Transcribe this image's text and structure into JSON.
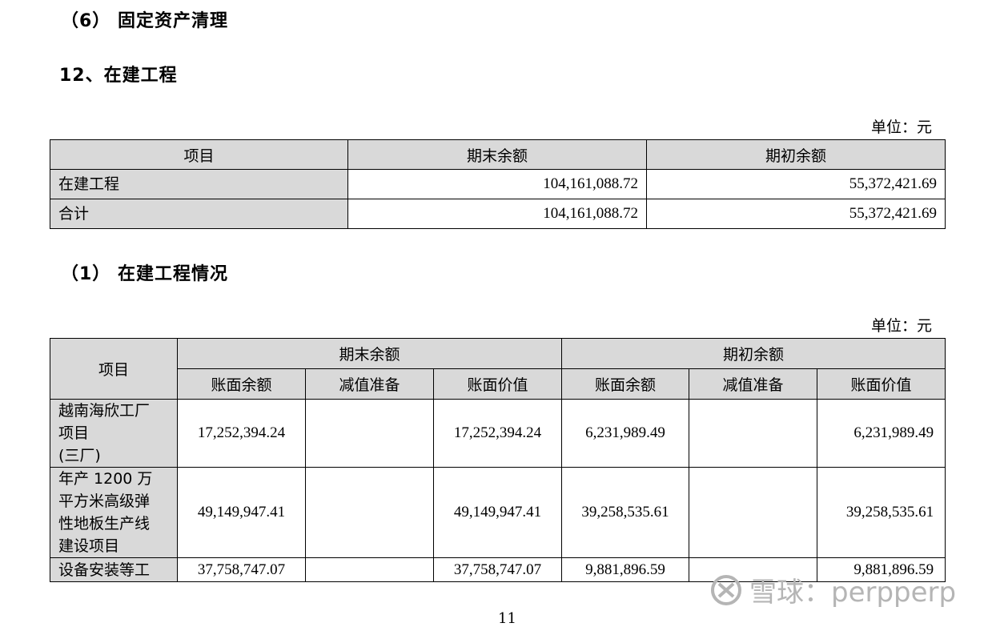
{
  "headings": {
    "fixed_asset_cleanup": "（6） 固定资产清理",
    "construction_in_progress": "12、在建工程",
    "cip_details": "（1） 在建工程情况"
  },
  "unit_label": "单位：元",
  "table1": {
    "headers": [
      "项目",
      "期末余额",
      "期初余额"
    ],
    "rows": [
      {
        "item": "在建工程",
        "end": "104,161,088.72",
        "begin": "55,372,421.69"
      },
      {
        "item": "合计",
        "end": "104,161,088.72",
        "begin": "55,372,421.69"
      }
    ]
  },
  "table2": {
    "item_header": "项目",
    "group_headers": [
      "期末余额",
      "期初余额"
    ],
    "sub_headers": [
      "账面余额",
      "减值准备",
      "账面价值",
      "账面余额",
      "减值准备",
      "账面价值"
    ],
    "rows": [
      {
        "item_lines": [
          "越南海欣工厂",
          "项目",
          "(三厂)"
        ],
        "values": [
          "17,252,394.24",
          "",
          "17,252,394.24",
          "6,231,989.49",
          "",
          "6,231,989.49"
        ]
      },
      {
        "item_lines": [
          "年产 1200 万",
          "平方米高级弹",
          "性地板生产线",
          "建设项目"
        ],
        "values": [
          "49,149,947.41",
          "",
          "49,149,947.41",
          "39,258,535.61",
          "",
          "39,258,535.61"
        ]
      },
      {
        "item_lines": [
          "设备安装等工"
        ],
        "values": [
          "37,758,747.07",
          "",
          "37,758,747.07",
          "9,881,896.59",
          "",
          "9,881,896.59"
        ]
      }
    ]
  },
  "watermark": "雪球：perpperp",
  "page_number": "11"
}
